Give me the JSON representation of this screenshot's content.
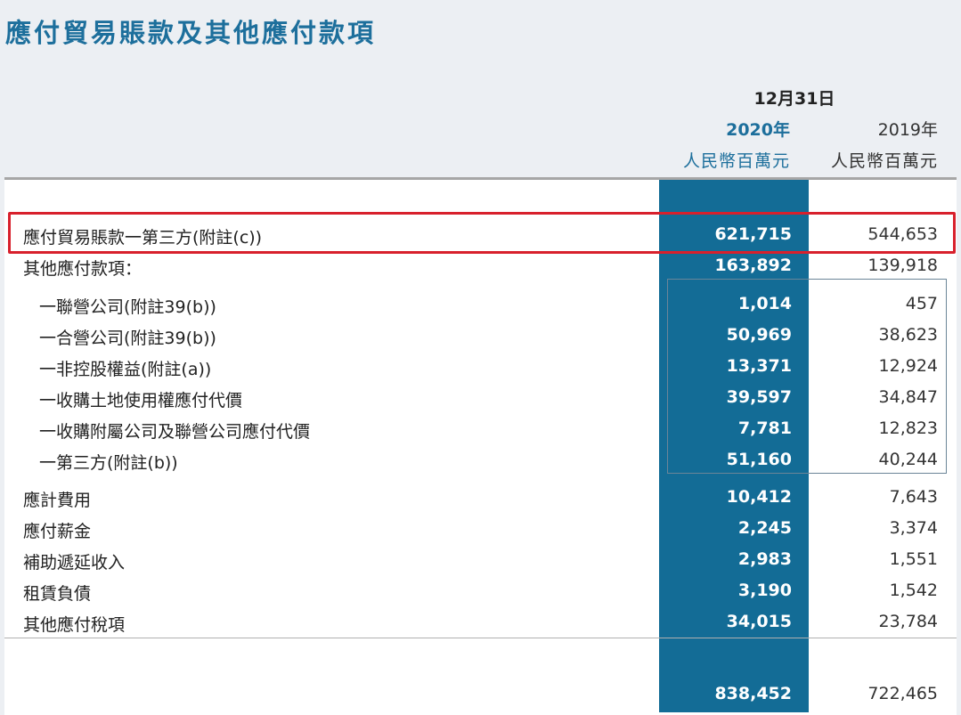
{
  "title": "應付貿易賬款及其他應付款項",
  "header": {
    "period": "12月31日",
    "year_current": "2020年",
    "year_prior": "2019年",
    "unit_current": "人民幣百萬元",
    "unit_prior": "人民幣百萬元"
  },
  "colors": {
    "title": "#1d6f9c",
    "band": "#136c96",
    "highlight": "#d8202c"
  },
  "rows": [
    {
      "label": "應付貿易賬款一第三方(附註(c))",
      "current": "621,715",
      "prior": "544,653"
    },
    {
      "label": "其他應付款項：",
      "current": "163,892",
      "prior": "139,918"
    },
    {
      "label": "一聯營公司(附註39(b))",
      "current": "1,014",
      "prior": "457"
    },
    {
      "label": "一合營公司(附註39(b))",
      "current": "50,969",
      "prior": "38,623"
    },
    {
      "label": "一非控股權益(附註(a))",
      "current": "13,371",
      "prior": "12,924"
    },
    {
      "label": "一收購土地使用權應付代價",
      "current": "39,597",
      "prior": "34,847"
    },
    {
      "label": "一收購附屬公司及聯營公司應付代價",
      "current": "7,781",
      "prior": "12,823"
    },
    {
      "label": "一第三方(附註(b))",
      "current": "51,160",
      "prior": "40,244"
    },
    {
      "label": "應計費用",
      "current": "10,412",
      "prior": "7,643"
    },
    {
      "label": "應付薪金",
      "current": "2,245",
      "prior": "3,374"
    },
    {
      "label": "補助遞延收入",
      "current": "2,983",
      "prior": "1,551"
    },
    {
      "label": "租賃負債",
      "current": "3,190",
      "prior": "1,542"
    },
    {
      "label": "其他應付稅項",
      "current": "34,015",
      "prior": "23,784"
    }
  ],
  "total": {
    "current": "838,452",
    "prior": "722,465"
  }
}
